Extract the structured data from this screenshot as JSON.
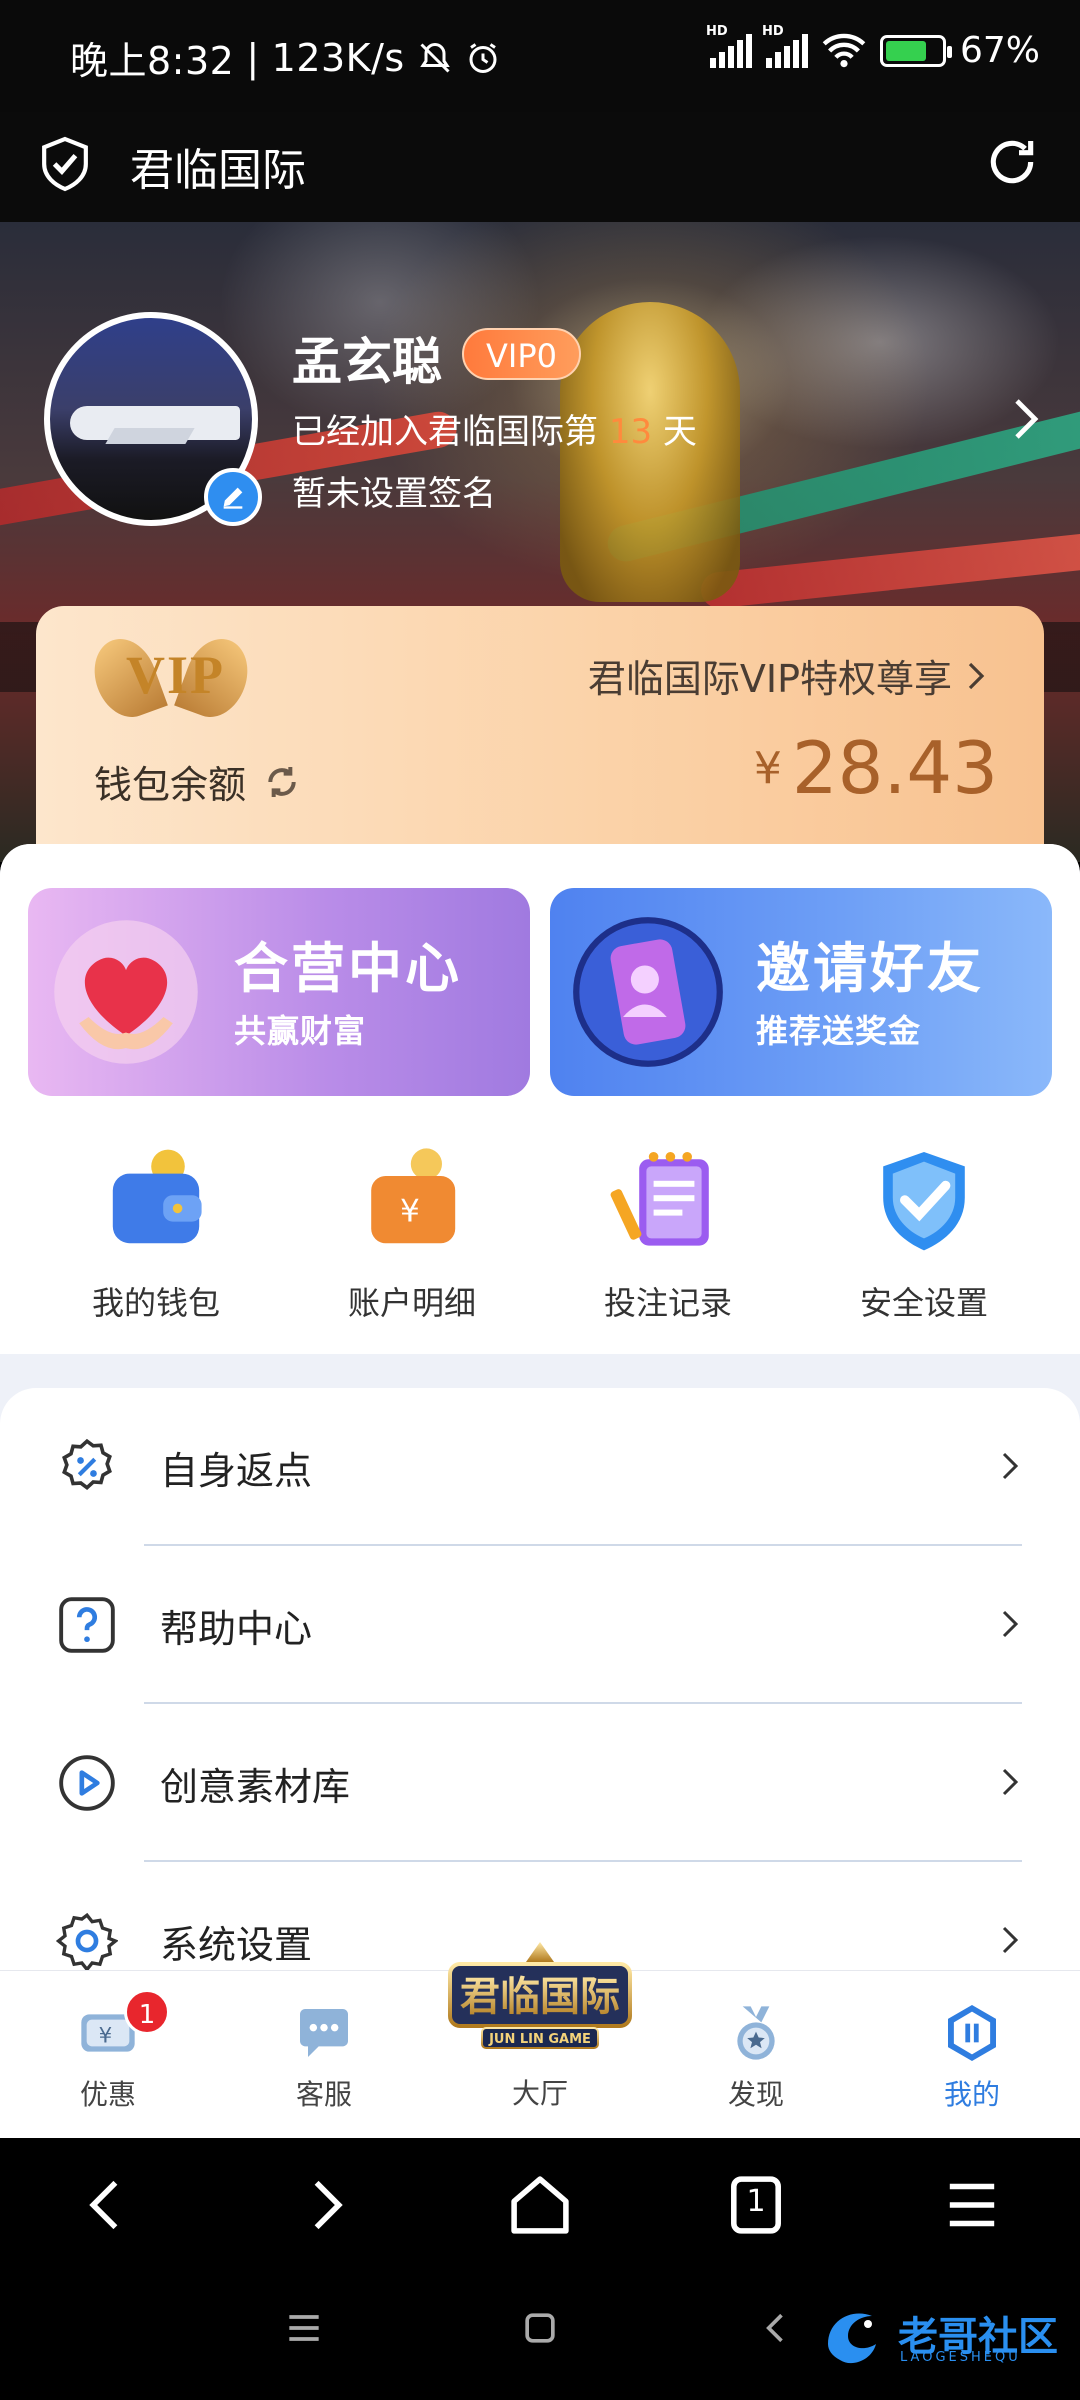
{
  "status_bar": {
    "time": "晚上8:32",
    "speed": "123K/s",
    "battery_percent": "67%",
    "sim1_label": "HD",
    "sim2_label": "HD"
  },
  "app": {
    "title": "君临国际"
  },
  "profile": {
    "name": "孟玄聪",
    "vip_level": "VIP0",
    "joined_prefix": "已经加入君临国际第",
    "joined_days": "13",
    "joined_suffix": "天",
    "signature": "暂未设置签名"
  },
  "vip_card": {
    "logo_text": "VIP",
    "privilege_text": "君临国际VIP特权尊享",
    "wallet_label": "钱包余额",
    "currency_symbol": "¥",
    "balance": "28.43"
  },
  "promos": [
    {
      "title": "合营中心",
      "subtitle": "共赢财富"
    },
    {
      "title": "邀请好友",
      "subtitle": "推荐送奖金"
    }
  ],
  "quick_actions": [
    {
      "label": "我的钱包",
      "icon": "wallet-icon"
    },
    {
      "label": "账户明细",
      "icon": "account-details-icon"
    },
    {
      "label": "投注记录",
      "icon": "bet-record-icon"
    },
    {
      "label": "安全设置",
      "icon": "security-shield-icon"
    }
  ],
  "menu": [
    {
      "label": "自身返点",
      "icon": "percent-badge-icon"
    },
    {
      "label": "帮助中心",
      "icon": "question-icon"
    },
    {
      "label": "创意素材库",
      "icon": "play-icon"
    },
    {
      "label": "系统设置",
      "icon": "gear-icon"
    }
  ],
  "tabs": [
    {
      "label": "优惠",
      "icon": "coupon-icon",
      "badge": "1"
    },
    {
      "label": "客服",
      "icon": "chat-icon"
    },
    {
      "label": "大厅",
      "icon": "hall-logo"
    },
    {
      "label": "发现",
      "icon": "medal-icon"
    },
    {
      "label": "我的",
      "icon": "profile-icon",
      "active": true
    }
  ],
  "hall_logo": {
    "text": "君临国际",
    "subtext": "JUN LIN GAME"
  },
  "browser_nav": {
    "tab_count": "1"
  },
  "watermark": {
    "text": "老哥社区",
    "subtext": "LAOGESHEQU"
  },
  "colors": {
    "accent_blue": "#2f7de0",
    "badge_red": "#e8262d",
    "days_orange": "#ff8a3d",
    "balance_brown": "#a8612a"
  }
}
